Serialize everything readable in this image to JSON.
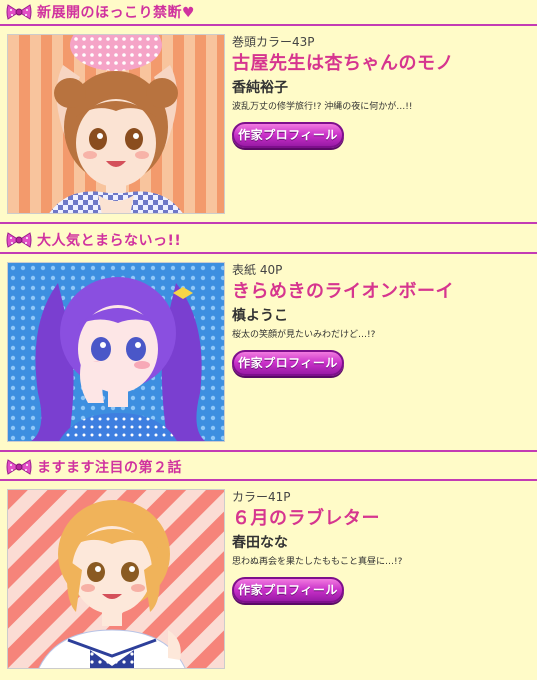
{
  "colors": {
    "background": "#fffbc8",
    "accent": "#d0329f",
    "title": "#d6358f",
    "button": "#c830c8"
  },
  "sections": [
    {
      "heading": "新展開のほっこり禁断♥",
      "page_info": "巻頭カラー43P",
      "title": "古屋先生は杏ちゃんのモノ",
      "author": "香純裕子",
      "blurb": "波乱万丈の修学旅行!? 沖縄の夜に何かが…!!",
      "button_label": "作家プロフィール"
    },
    {
      "heading": "大人気とまらないっ!!",
      "page_info": "表紙 40P",
      "title": "きらめきのライオンボーイ",
      "author": "槙ようこ",
      "blurb": "桜太の笑顔が見たいみわだけど…!?",
      "button_label": "作家プロフィール"
    },
    {
      "heading": "ますます注目の第２話",
      "page_info": "カラー41P",
      "title": "６月のラブレター",
      "author": "春田なな",
      "blurb": "思わぬ再会を果たしたももこと真昼に…!?",
      "button_label": "作家プロフィール"
    }
  ]
}
